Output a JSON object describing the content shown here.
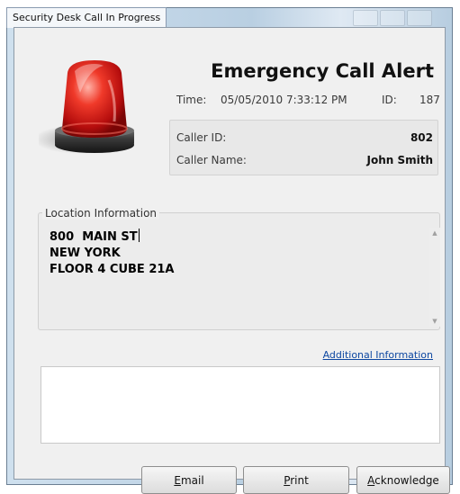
{
  "window": {
    "title": "Security Desk Call In Progress"
  },
  "header": {
    "title": "Emergency Call Alert",
    "time_label": "Time:",
    "time_value": "05/05/2010 7:33:12 PM",
    "id_label": "ID:",
    "id_value": "187"
  },
  "caller": {
    "id_label": "Caller ID:",
    "id_value": "802",
    "name_label": "Caller Name:",
    "name_value": "John Smith"
  },
  "location": {
    "legend": "Location Information",
    "lines": [
      "800  MAIN ST",
      "NEW YORK",
      "FLOOR 4 CUBE 21A"
    ]
  },
  "links": {
    "additional_info": "Additional Information"
  },
  "notes": {
    "value": ""
  },
  "buttons": {
    "email_accel": "E",
    "email_rest": "mail",
    "print_accel": "P",
    "print_rest": "rint",
    "ack_accel": "A",
    "ack_rest": "cknowledge"
  },
  "colors": {
    "siren_red": "#d21414",
    "link_blue": "#0d47a1"
  },
  "icons": {
    "siren": "emergency-siren-icon"
  }
}
